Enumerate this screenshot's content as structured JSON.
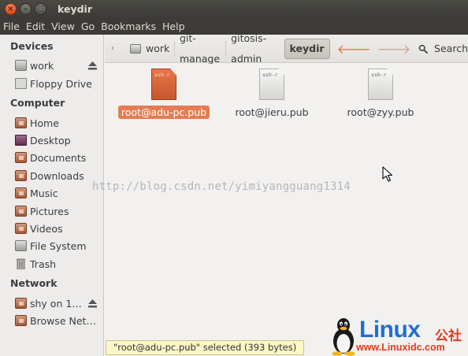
{
  "window": {
    "title": "keydir"
  },
  "menu": [
    "File",
    "Edit",
    "View",
    "Go",
    "Bookmarks",
    "Help"
  ],
  "sidebar": {
    "devices_title": "Devices",
    "devices": [
      {
        "label": "work",
        "icon": "drive-icon",
        "eject": true
      },
      {
        "label": "Floppy Drive",
        "icon": "floppy-icon",
        "eject": false
      }
    ],
    "computer_title": "Computer",
    "computer": [
      {
        "label": "Home",
        "icon": "home-folder-icon"
      },
      {
        "label": "Desktop",
        "icon": "desktop-icon"
      },
      {
        "label": "Documents",
        "icon": "documents-folder-icon"
      },
      {
        "label": "Downloads",
        "icon": "downloads-folder-icon"
      },
      {
        "label": "Music",
        "icon": "music-folder-icon"
      },
      {
        "label": "Pictures",
        "icon": "pictures-folder-icon"
      },
      {
        "label": "Videos",
        "icon": "videos-folder-icon"
      },
      {
        "label": "File System",
        "icon": "filesystem-icon"
      },
      {
        "label": "Trash",
        "icon": "trash-icon"
      }
    ],
    "network_title": "Network",
    "network": [
      {
        "label": "shy on 1…",
        "icon": "network-share-icon",
        "eject": true
      },
      {
        "label": "Browse Net…",
        "icon": "network-folder-icon",
        "eject": false
      }
    ]
  },
  "toolbar": {
    "breadcrumbs": [
      "work",
      "git-manage",
      "gitosis-admin",
      "keydir"
    ],
    "active_crumb": "keydir",
    "search_label": "Search"
  },
  "files": [
    {
      "name": "root@adu-pc.pub",
      "preview": "ssh-r",
      "selected": true
    },
    {
      "name": "root@jieru.pub",
      "preview": "ssh-r",
      "selected": false
    },
    {
      "name": "root@zyy.pub",
      "preview": "ssh-r",
      "selected": false
    }
  ],
  "watermark": "http://blog.csdn.net/yimiyangguang1314",
  "status": "\"root@adu-pc.pub\" selected (393 bytes)",
  "logo": {
    "word": "Linux",
    "cn": "公社",
    "url": "www.Linuxidc.com"
  },
  "colors": {
    "accent": "#e67c52",
    "titlebar": "#3c3b37",
    "logo_blue": "#1f6fd1",
    "logo_red": "#e23b1c"
  }
}
